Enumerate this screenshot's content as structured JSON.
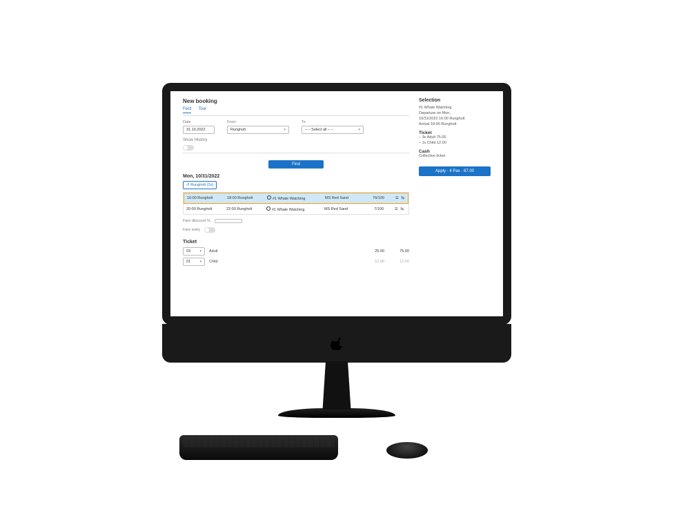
{
  "page": {
    "title": "New booking",
    "tabs": {
      "active": "Ferd",
      "inactive": "Tour"
    }
  },
  "filters": {
    "date_label": "Date",
    "date_value": "31.10.2022",
    "from_label": "From",
    "from_value": "Rungholt",
    "to_label": "To",
    "to_value": "– – Select all – –",
    "show_history_label": "Show History"
  },
  "actions": {
    "find_label": "Find",
    "apply_label": "Apply · 4 Pax · 87.00"
  },
  "results": {
    "date_heading": "Mon, 10/31/2022",
    "route_pill": "↺ Rungholt (2x)",
    "rows": [
      {
        "dep": "16:00 Rungholt",
        "arr": "18:00 Rungholt",
        "tour": "#1 Whale Watching",
        "ship": "MS Red Sand",
        "cap": "76/100",
        "selected": true
      },
      {
        "dep": "20:00 Rungholt",
        "arr": "22:00 Rungholt",
        "tour": "#1 Whale Watching",
        "ship": "MS Red Sand",
        "cap": "7/100",
        "selected": false
      }
    ]
  },
  "fare": {
    "discount_label": "Fare discount %",
    "discount_value": "",
    "free_entry_label": "Fare entry"
  },
  "ticket": {
    "heading": "Ticket",
    "lines": [
      {
        "qty": "03",
        "name": "Adult",
        "unit": "25.00",
        "total": "75.00",
        "muted": false
      },
      {
        "qty": "01",
        "name": "Child",
        "unit": "12.00",
        "total": "12.00",
        "muted": true
      }
    ]
  },
  "selection": {
    "heading": "Selection",
    "tour": "#1 Whale Watching",
    "departure_label": "Departure on Mon,",
    "departure_value": "10/31/2022 16:00 Rungholt",
    "arrival_value": "Arrival 18:00 Rungholt",
    "ticket_heading": "Ticket",
    "ticket_lines": [
      "3x Adult 75.00",
      "1x Child 12.00"
    ],
    "payment": "Cash",
    "ticket_type": "Collective ticket"
  }
}
